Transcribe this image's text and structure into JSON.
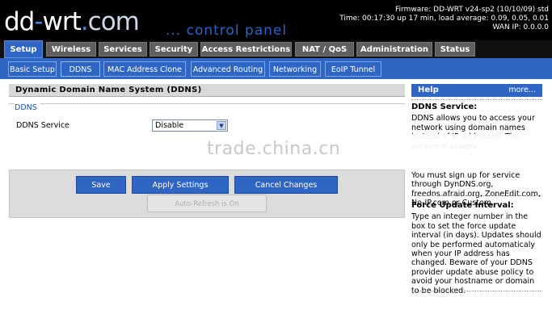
{
  "header": {
    "logo_main": "dd",
    "logo_sep": "-",
    "logo_mid": "wrt",
    "logo_dot": ".",
    "logo_tail": "com",
    "tagline": "... control panel",
    "firmware": "Firmware: DD-WRT v24-sp2 (10/10/09) std",
    "time": "Time: 00:17:30 up 17 min, load average: 0.09, 0.05, 0.01",
    "wan_ip": "WAN IP: 0.0.0.0"
  },
  "main_tabs": [
    {
      "label": "Setup",
      "active": true
    },
    {
      "label": "Wireless"
    },
    {
      "label": "Services"
    },
    {
      "label": "Security"
    },
    {
      "label": "Access Restrictions"
    },
    {
      "label": "NAT / QoS"
    },
    {
      "label": "Administration"
    },
    {
      "label": "Status"
    }
  ],
  "sub_tabs": [
    {
      "label": "Basic Setup"
    },
    {
      "label": "DDNS",
      "active": true
    },
    {
      "label": "MAC Address Clone"
    },
    {
      "label": "Advanced Routing"
    },
    {
      "label": "Networking"
    },
    {
      "label": "EoIP Tunnel"
    }
  ],
  "content": {
    "section_title": "Dynamic Domain Name System (DDNS)",
    "legend": "DDNS",
    "field_label": "DDNS Service",
    "field_value": "Disable"
  },
  "buttons": {
    "save": "Save",
    "apply": "Apply Settings",
    "cancel": "Cancel Changes",
    "auto_refresh": "Auto-Refresh is On"
  },
  "watermark": "trade.china.cn",
  "help": {
    "title": "Help",
    "more": "more...",
    "ddns_heading": "DDNS Service:",
    "ddns_text": "DDNS allows you to access your network using domain names instead of IP addresses. The service manages",
    "ddns_text2": "You must sign up for service through DynDNS.org, freedns.afraid.org, ZoneEdit.com, No-IP.com or Custom.",
    "force_heading": "Force Update Interval:",
    "force_text": "Type an integer number in the box to set the force update interval (in days). Updates should only be performed automaticaly when your IP address has changed. Beware of your DDNS provider update abuse policy to avoid your hostname or domain to be blocked."
  }
}
